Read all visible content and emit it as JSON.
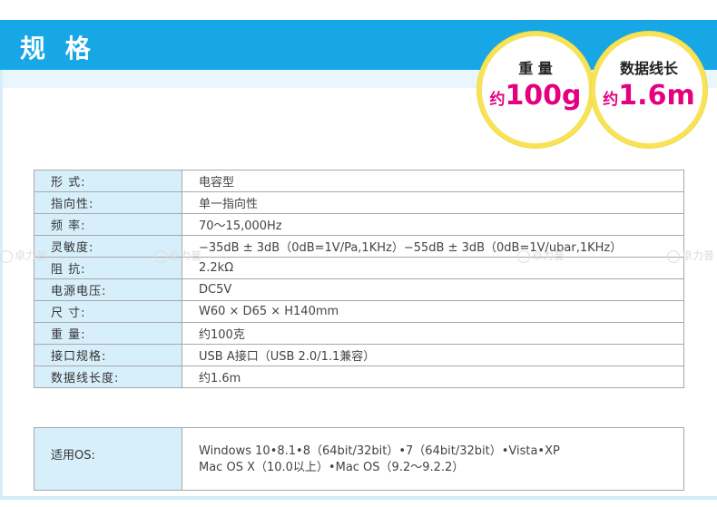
{
  "header": {
    "title": "规 格"
  },
  "badges": {
    "weight": {
      "label": "重 量",
      "prefix": "约",
      "value": "100g"
    },
    "cable": {
      "label": "数据线长",
      "prefix": "约",
      "value": "1.6m"
    }
  },
  "specs": [
    {
      "key": "形 式:",
      "value": "电容型"
    },
    {
      "key": "指向性:",
      "value": "单一指向性"
    },
    {
      "key": "频 率:",
      "value": "70～15,000Hz"
    },
    {
      "key": "灵敏度:",
      "value": "−35dB ± 3dB（0dB=1V/Pa,1KHz）−55dB ± 3dB（0dB=1V/ubar,1KHz）"
    },
    {
      "key": "阻 抗:",
      "value": "2.2kΩ"
    },
    {
      "key": "电源电压:",
      "value": "DC5V"
    },
    {
      "key": "尺 寸:",
      "value": "W60 × D65 × H140mm"
    },
    {
      "key": "重 量:",
      "value": "约100克"
    },
    {
      "key": "接口规格:",
      "value": "USB A接口（USB 2.0/1.1兼容）"
    },
    {
      "key": "数据线长度:",
      "value": "约1.6m"
    }
  ],
  "os": {
    "key": "适用OS:",
    "line1": "Windows 10•8.1•8（64bit/32bit）•7（64bit/32bit）•Vista•XP",
    "line2": "Mac OS X（10.0以上）•Mac OS（9.2～9.2.2）"
  },
  "watermark": {
    "text": "卓力普"
  }
}
